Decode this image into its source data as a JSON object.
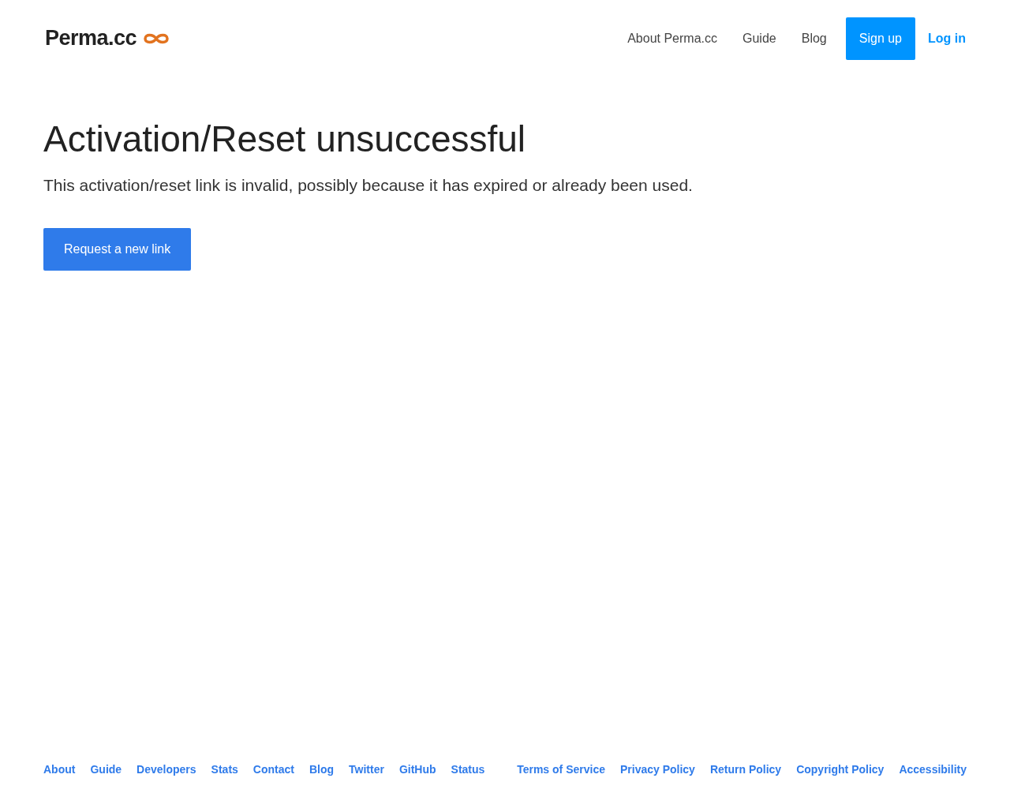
{
  "header": {
    "logo": "Perma.cc",
    "nav": [
      "About Perma.cc",
      "Guide",
      "Blog"
    ],
    "signup": "Sign up",
    "login": "Log in"
  },
  "main": {
    "title": "Activation/Reset unsuccessful",
    "message": "This activation/reset link is invalid, possibly because it has expired or already been used.",
    "button": "Request a new link"
  },
  "footer": {
    "left_links": [
      "About",
      "Guide",
      "Developers",
      "Stats",
      "Contact",
      "Blog",
      "Twitter",
      "GitHub",
      "Status"
    ],
    "right_links": [
      "Terms of Service",
      "Privacy Policy",
      "Return Policy",
      "Copyright Policy",
      "Accessibility"
    ]
  }
}
